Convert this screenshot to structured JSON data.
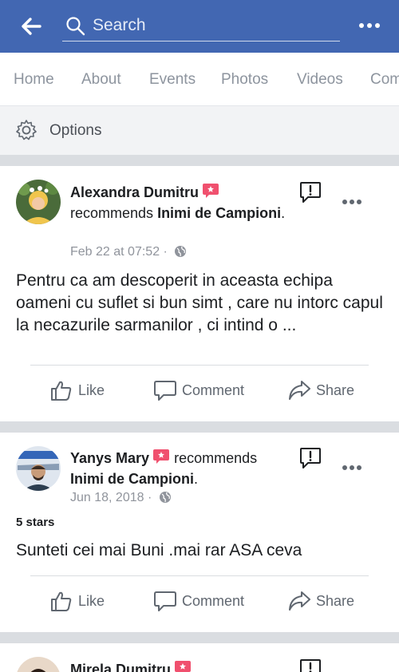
{
  "header": {
    "search_placeholder": "Search"
  },
  "tabs": [
    "Home",
    "About",
    "Events",
    "Photos",
    "Videos",
    "Com"
  ],
  "options_label": "Options",
  "posts": [
    {
      "author": "Alexandra Dumitru",
      "recommends": "recommends",
      "page": "Inimi de Campioni",
      "period": ".",
      "date": "Feb 22 at 07:52",
      "dot": "·",
      "rating": "",
      "text": "Pentru ca am descoperit in aceasta echipa oameni cu suflet si bun simt , care nu intorc capul la necazurile sarmanilor , ci intind o ...",
      "actions": {
        "like": "Like",
        "comment": "Comment",
        "share": "Share"
      }
    },
    {
      "author": "Yanys Mary",
      "recommends": "recommends",
      "page": "Inimi de Campioni",
      "period": ".",
      "date": "Jun 18, 2018",
      "dot": "·",
      "rating": "5 stars",
      "text": "Sunteti cei mai Buni  .mai rar ASA ceva",
      "actions": {
        "like": "Like",
        "comment": "Comment",
        "share": "Share"
      }
    },
    {
      "author": "Mirela Dumitru"
    }
  ],
  "colors": {
    "brand": "#4267b2",
    "recommend_badge": "#f0506e",
    "muted": "#90949c"
  }
}
